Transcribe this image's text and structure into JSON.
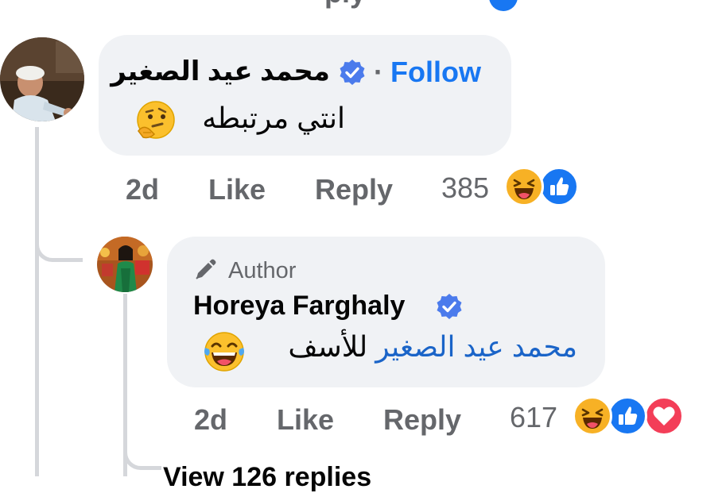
{
  "top_fragment": {
    "text": "ply"
  },
  "comment1": {
    "author": "محمد عيد الصغير",
    "follow_label": "Follow",
    "separator": "·",
    "text": "انتي مرتبطه",
    "emoji_icon": "thinking-face",
    "time": "2d",
    "like_label": "Like",
    "reply_label": "Reply",
    "reaction_count": "385",
    "reactions": [
      "haha",
      "like"
    ]
  },
  "reply1": {
    "badge": "Author",
    "badge_icon": "pen-icon",
    "author": "Horeya Farghaly",
    "mention": "محمد عيد الصغير",
    "text": "للأسف",
    "emoji_icon": "laughing-tears",
    "time": "2d",
    "like_label": "Like",
    "reply_label": "Reply",
    "reaction_count": "617",
    "reactions": [
      "haha",
      "like",
      "love"
    ]
  },
  "view_replies": {
    "label": "View 126 replies"
  },
  "colors": {
    "link_blue": "#1877f2",
    "meta_gray": "#65676b",
    "bubble_gray": "#f0f2f5",
    "love_red": "#f33e58",
    "haha_yellow": "#f7b125"
  }
}
